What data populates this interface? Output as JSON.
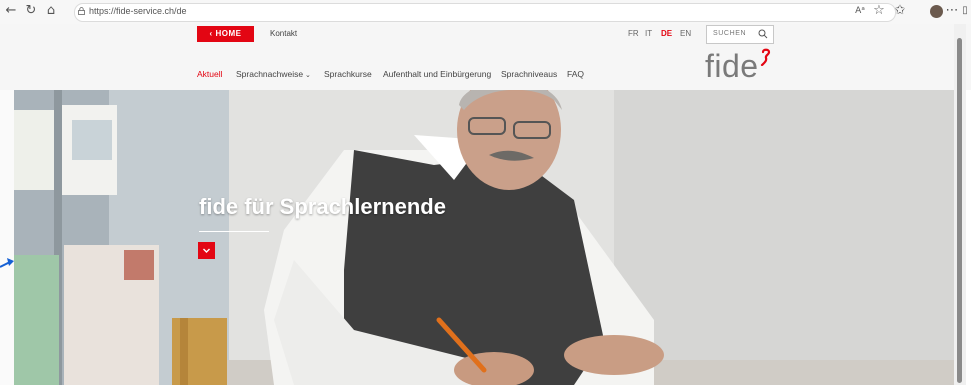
{
  "browser": {
    "url": "https://fide-service.ch/de",
    "icons": [
      "back-icon",
      "refresh-icon",
      "home-icon",
      "lock-icon",
      "read-aloud-icon",
      "favorite-icon",
      "collections-icon",
      "profile-icon",
      "more-icon",
      "sidebar-icon"
    ]
  },
  "header": {
    "home_label": "HOME",
    "contact_label": "Kontakt",
    "languages": [
      "FR",
      "IT",
      "DE",
      "EN"
    ],
    "active_language": "DE",
    "search_placeholder": "SUCHEN",
    "logo_text": "fide"
  },
  "nav": {
    "items": [
      {
        "label": "Aktuell",
        "active": true
      },
      {
        "label": "Sprachnachweise",
        "has_dropdown": true
      },
      {
        "label": "Sprachkurse"
      },
      {
        "label": "Aufenthalt und Einbürgerung"
      },
      {
        "label": "Sprachniveaus"
      },
      {
        "label": "FAQ"
      }
    ]
  },
  "hero": {
    "title": "fide für Sprachlernende"
  },
  "colors": {
    "brand_red": "#e30613",
    "header_bg": "#f6f6f6",
    "logo_grey": "#7a7a7a"
  }
}
